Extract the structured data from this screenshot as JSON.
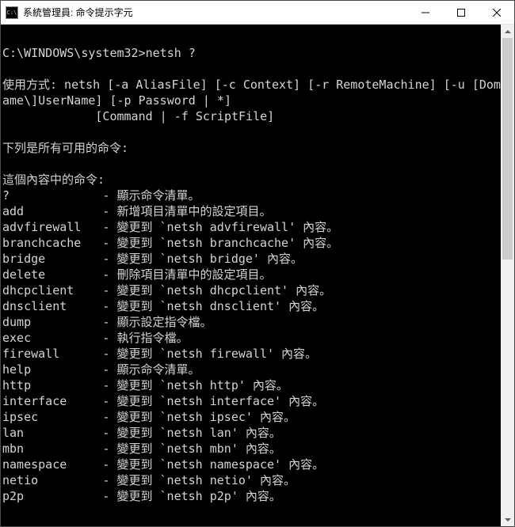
{
  "titlebar": {
    "icon_label": "C:\\",
    "title": "系統管理員: 命令提示字元"
  },
  "terminal": {
    "blank": "",
    "prompt": "C:\\WINDOWS\\system32>",
    "entered_command": "netsh ?",
    "usage_label": "使用方式: ",
    "usage_line1": "netsh [-a AliasFile] [-c Context] [-r RemoteMachine] [-u [DomainN",
    "usage_line2": "ame\\]UserName] [-p Password | *]",
    "usage_line3": "             [Command | -f ScriptFile]",
    "avail_heading": "下列是所有可用的命令:",
    "context_heading": "這個內容中的命令:",
    "commands": [
      {
        "name": "?",
        "desc": "- 顯示命令清單。"
      },
      {
        "name": "add",
        "desc": "- 新增項目清單中的設定項目。"
      },
      {
        "name": "advfirewall",
        "desc": "- 變更到 `netsh advfirewall' 內容。"
      },
      {
        "name": "branchcache",
        "desc": "- 變更到 `netsh branchcache' 內容。"
      },
      {
        "name": "bridge",
        "desc": "- 變更到 `netsh bridge' 內容。"
      },
      {
        "name": "delete",
        "desc": "- 刪除項目清單中的設定項目。"
      },
      {
        "name": "dhcpclient",
        "desc": "- 變更到 `netsh dhcpclient' 內容。"
      },
      {
        "name": "dnsclient",
        "desc": "- 變更到 `netsh dnsclient' 內容。"
      },
      {
        "name": "dump",
        "desc": "- 顯示設定指令檔。"
      },
      {
        "name": "exec",
        "desc": "- 執行指令檔。"
      },
      {
        "name": "firewall",
        "desc": "- 變更到 `netsh firewall' 內容。"
      },
      {
        "name": "help",
        "desc": "- 顯示命令清單。"
      },
      {
        "name": "http",
        "desc": "- 變更到 `netsh http' 內容。"
      },
      {
        "name": "interface",
        "desc": "- 變更到 `netsh interface' 內容。"
      },
      {
        "name": "ipsec",
        "desc": "- 變更到 `netsh ipsec' 內容。"
      },
      {
        "name": "lan",
        "desc": "- 變更到 `netsh lan' 內容。"
      },
      {
        "name": "mbn",
        "desc": "- 變更到 `netsh mbn' 內容。"
      },
      {
        "name": "namespace",
        "desc": "- 變更到 `netsh namespace' 內容。"
      },
      {
        "name": "netio",
        "desc": "- 變更到 `netsh netio' 內容。"
      },
      {
        "name": "p2p",
        "desc": "- 變更到 `netsh p2p' 內容。"
      }
    ]
  }
}
